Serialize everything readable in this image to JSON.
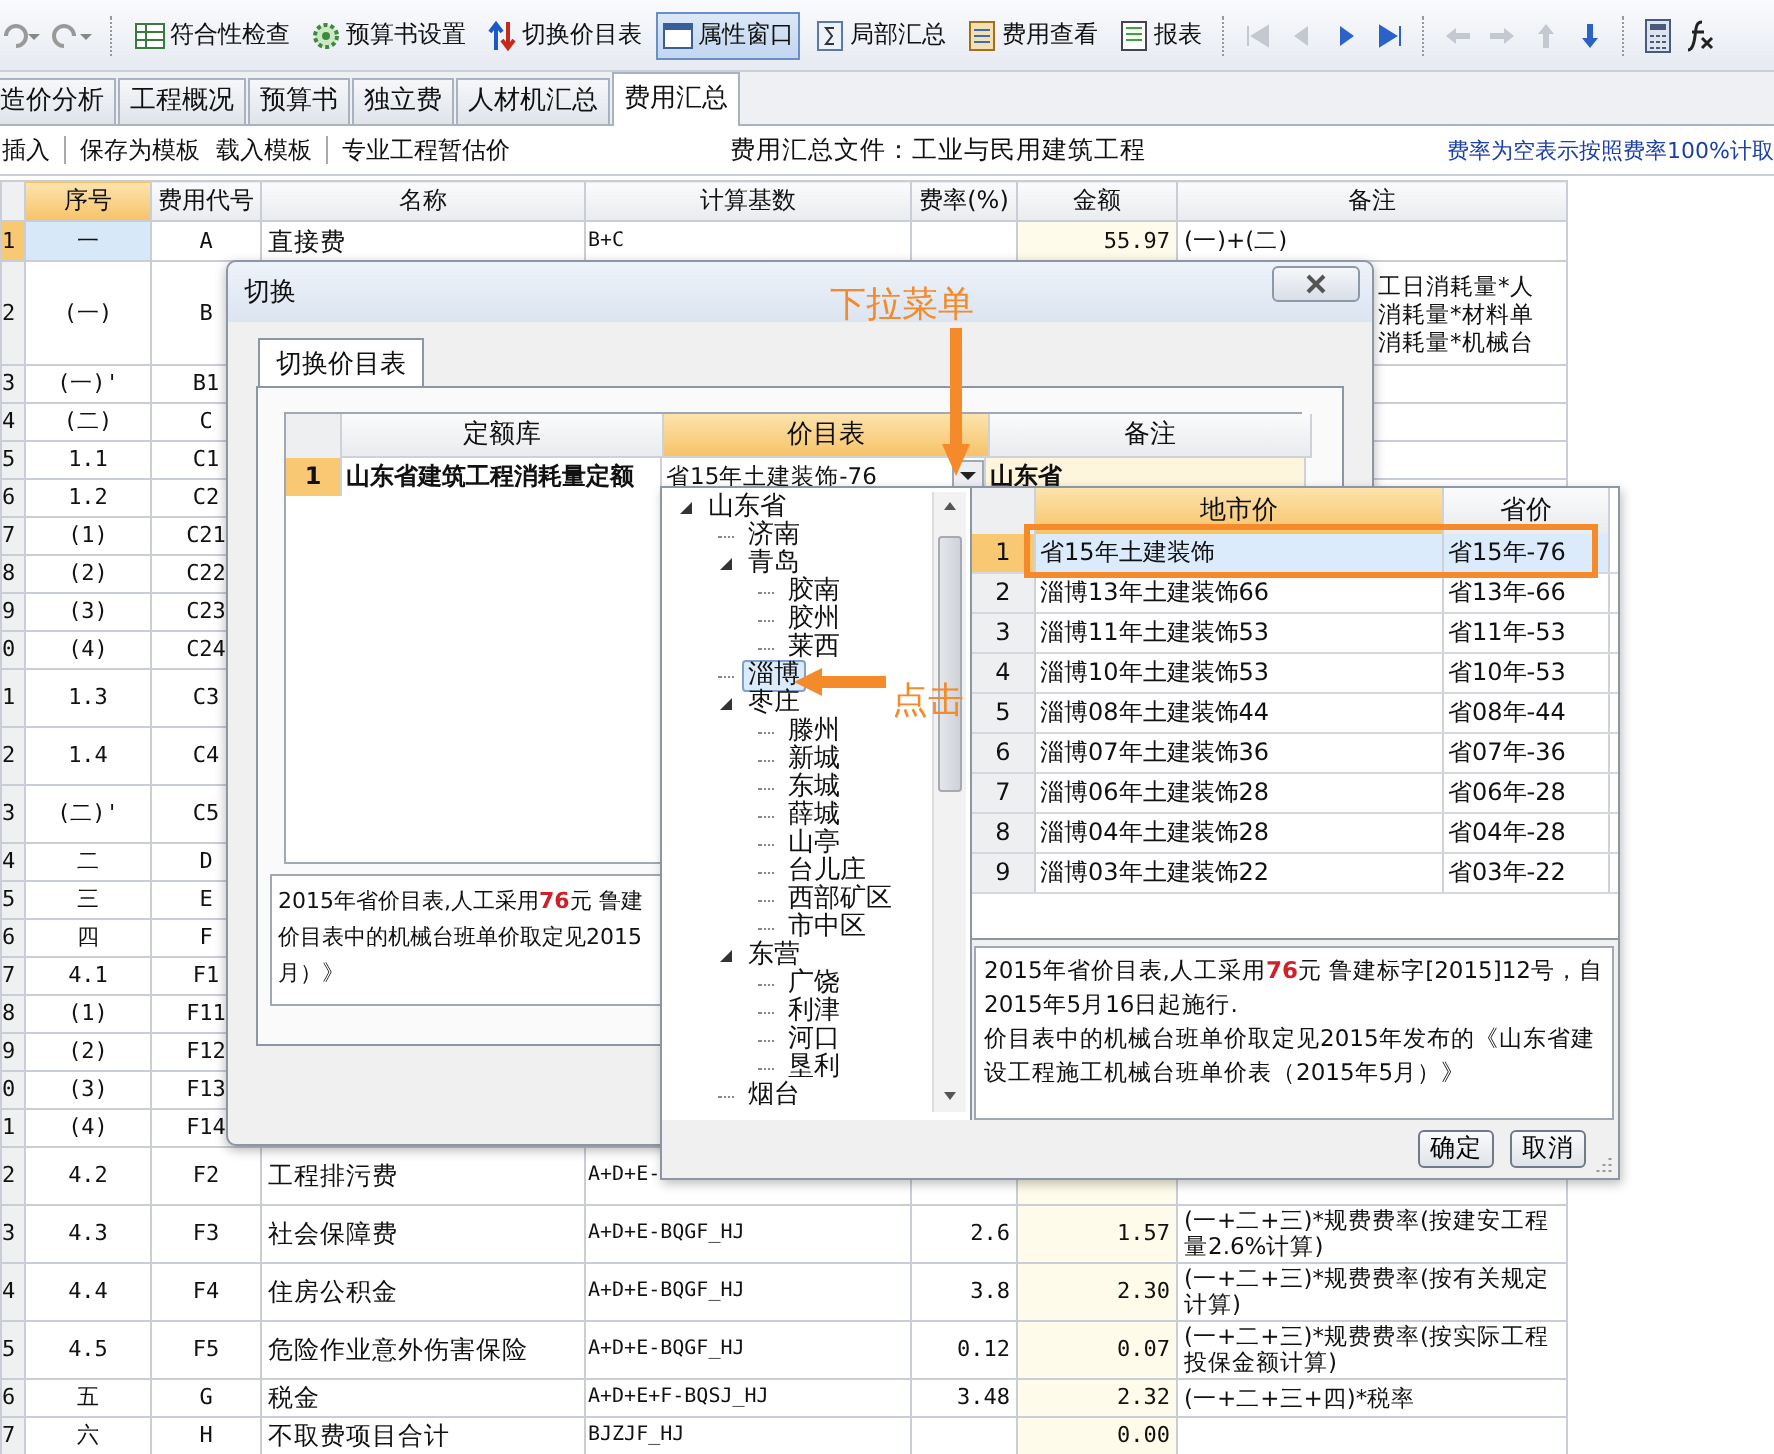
{
  "toolbar": {
    "buttons": [
      {
        "label": "符合性检查",
        "pressed": false
      },
      {
        "label": "预算书设置",
        "pressed": false
      },
      {
        "label": "切换价目表",
        "pressed": false
      },
      {
        "label": "属性窗口",
        "pressed": true
      },
      {
        "label": "局部汇总",
        "pressed": false
      },
      {
        "label": "费用查看",
        "pressed": false
      },
      {
        "label": "报表",
        "pressed": false
      }
    ]
  },
  "tabs": [
    {
      "label": "造价分析",
      "selected": false
    },
    {
      "label": "工程概况",
      "selected": false
    },
    {
      "label": "预算书",
      "selected": false
    },
    {
      "label": "独立费",
      "selected": false
    },
    {
      "label": "人材机汇总",
      "selected": false
    },
    {
      "label": "费用汇总",
      "selected": true
    }
  ],
  "subtoolbar": {
    "actions": [
      "插入",
      "保存为模板",
      "载入模板",
      "专业工程暂估价"
    ],
    "file_label": "费用汇总文件：工业与民用建筑工程",
    "note": "费率为空表示按照费率100%计取"
  },
  "table": {
    "columns": [
      "序号",
      "费用代号",
      "名称",
      "计算基数",
      "费率(%)",
      "金额",
      "备注"
    ],
    "rows": [
      {
        "row_number": "1",
        "serial": "一",
        "code": "A",
        "name": "直接费",
        "base": "B+C",
        "amount": "55.97",
        "remark": "(一)+(二)",
        "selected": true
      },
      {
        "row_number": "2",
        "serial": "(一)",
        "code": "B",
        "remark": "工日消耗量*人消耗量*材料单消耗量*机械台",
        "selected": false
      },
      {
        "row_number": "3",
        "serial": "(一)'",
        "code": "B1",
        "selected": false
      },
      {
        "row_number": "4",
        "serial": "(二)",
        "code": "C",
        "selected": false
      },
      {
        "row_number": "5",
        "serial": "1.1",
        "code": "C1",
        "selected": false
      },
      {
        "row_number": "6",
        "serial": "1.2",
        "code": "C2",
        "selected": false
      },
      {
        "row_number": "7",
        "serial": "(1)",
        "code": "C21",
        "selected": false
      },
      {
        "row_number": "8",
        "serial": "(2)",
        "code": "C22",
        "selected": false
      },
      {
        "row_number": "9",
        "serial": "(3)",
        "code": "C23",
        "selected": false
      },
      {
        "row_number": "0",
        "serial": "(4)",
        "code": "C24",
        "selected": false
      },
      {
        "row_number": "1",
        "serial": "1.3",
        "code": "C3",
        "selected": false
      },
      {
        "row_number": "2",
        "serial": "1.4",
        "code": "C4",
        "selected": false
      },
      {
        "row_number": "3",
        "serial": "(二)'",
        "code": "C5",
        "selected": false
      },
      {
        "row_number": "4",
        "serial": "二",
        "code": "D",
        "selected": false
      },
      {
        "row_number": "5",
        "serial": "三",
        "code": "E",
        "selected": false
      },
      {
        "row_number": "6",
        "serial": "四",
        "code": "F",
        "selected": false
      },
      {
        "row_number": "7",
        "serial": "4.1",
        "code": "F1",
        "selected": false
      },
      {
        "row_number": "8",
        "serial": "(1)",
        "code": "F11",
        "selected": false
      },
      {
        "row_number": "9",
        "serial": "(2)",
        "code": "F12",
        "selected": false
      },
      {
        "row_number": "0",
        "serial": "(3)",
        "code": "F13",
        "selected": false
      },
      {
        "row_number": "1",
        "serial": "(4)",
        "code": "F14",
        "selected": false
      },
      {
        "row_number": "2",
        "serial": "4.2",
        "code": "F2",
        "name": "工程排污费",
        "base": "A+D+E-",
        "selected": false
      },
      {
        "row_number": "3",
        "serial": "4.3",
        "code": "F3",
        "name": "社会保障费",
        "base": "A+D+E-BQGF_HJ",
        "rate": "2.6",
        "amount": "1.57",
        "remark": "(一+二+三)*规费费率(按建安工程量2.6%计算)",
        "selected": false
      },
      {
        "row_number": "4",
        "serial": "4.4",
        "code": "F4",
        "name": "住房公积金",
        "base": "A+D+E-BQGF_HJ",
        "rate": "3.8",
        "amount": "2.30",
        "remark": "(一+二+三)*规费费率(按有关规定计算)",
        "selected": false
      },
      {
        "row_number": "5",
        "serial": "4.5",
        "code": "F5",
        "name": "危险作业意外伤害保险",
        "base": "A+D+E-BQGF_HJ",
        "rate": "0.12",
        "amount": "0.07",
        "remark": "(一+二+三)*规费费率(按实际工程投保金额计算)",
        "selected": false
      },
      {
        "row_number": "6",
        "serial": "五",
        "code": "G",
        "name": "税金",
        "base": "A+D+E+F-BQSJ_HJ",
        "rate": "3.48",
        "amount": "2.32",
        "remark": "(一+二+三+四)*税率",
        "selected": false
      },
      {
        "row_number": "7",
        "serial": "六",
        "code": "H",
        "name": "不取费项目合计",
        "base": "BJZJF_HJ",
        "amount": "0.00",
        "selected": false
      }
    ]
  },
  "dialog": {
    "title": "切换",
    "tab": "切换价目表",
    "columns": [
      "定额库",
      "价目表",
      "备注"
    ],
    "rows": [
      {
        "row_number": "1",
        "quota_library": "山东省建筑工程消耗量定额",
        "price_list": "省15年土建装饰-76",
        "remark": "山东省"
      }
    ],
    "description_lines": [
      "2015年省价目表,人工采用**76**元 鲁建",
      "价目表中的机械台班单价取定见2015",
      "月）》"
    ]
  },
  "popup": {
    "tree": [
      {
        "label": "山东省",
        "expanded": true,
        "selected": false,
        "children": [
          {
            "label": "济南",
            "selected": false
          },
          {
            "label": "青岛",
            "expanded": true,
            "selected": false,
            "children": [
              {
                "label": "胶南",
                "selected": false
              },
              {
                "label": "胶州",
                "selected": false
              },
              {
                "label": "莱西",
                "selected": false
              }
            ]
          },
          {
            "label": "淄博",
            "selected": true
          },
          {
            "label": "枣庄",
            "expanded": true,
            "selected": false,
            "children": [
              {
                "label": "滕州",
                "selected": false
              },
              {
                "label": "新城",
                "selected": false
              },
              {
                "label": "东城",
                "selected": false
              },
              {
                "label": "薛城",
                "selected": false
              },
              {
                "label": "山亭",
                "selected": false
              },
              {
                "label": "台儿庄",
                "selected": false
              },
              {
                "label": "西部矿区",
                "selected": false
              },
              {
                "label": "市中区",
                "selected": false
              }
            ]
          },
          {
            "label": "东营",
            "expanded": true,
            "selected": false,
            "children": [
              {
                "label": "广饶",
                "selected": false
              },
              {
                "label": "利津",
                "selected": false
              },
              {
                "label": "河口",
                "selected": false
              },
              {
                "label": "垦利",
                "selected": false
              }
            ]
          },
          {
            "label": "烟台",
            "selected": false
          }
        ]
      }
    ],
    "columns": [
      "地市价",
      "省价"
    ],
    "rows": [
      {
        "row_number": "1",
        "city_price": "省15年土建装饰",
        "province_price": "省15年-76",
        "selected": true
      },
      {
        "row_number": "2",
        "city_price": "淄博13年土建装饰66",
        "province_price": "省13年-66",
        "selected": false
      },
      {
        "row_number": "3",
        "city_price": "淄博11年土建装饰53",
        "province_price": "省11年-53",
        "selected": false
      },
      {
        "row_number": "4",
        "city_price": "淄博10年土建装饰53",
        "province_price": "省10年-53",
        "selected": false
      },
      {
        "row_number": "5",
        "city_price": "淄博08年土建装饰44",
        "province_price": "省08年-44",
        "selected": false
      },
      {
        "row_number": "6",
        "city_price": "淄博07年土建装饰36",
        "province_price": "省07年-36",
        "selected": false
      },
      {
        "row_number": "7",
        "city_price": "淄博06年土建装饰28",
        "province_price": "省06年-28",
        "selected": false
      },
      {
        "row_number": "8",
        "city_price": "淄博04年土建装饰28",
        "province_price": "省04年-28",
        "selected": false
      },
      {
        "row_number": "9",
        "city_price": "淄博03年土建装饰22",
        "province_price": "省03年-22",
        "selected": false
      }
    ],
    "description": "2015年省价目表,人工采用**76**元 鲁建标字[2015]12号，自2015年5月16日起施行.\n价目表中的机械台班单价取定见2015年发布的《山东省建设工程施工机械台班单价表（2015年5月）》",
    "buttons": [
      "确定",
      "取消"
    ]
  },
  "annotations": {
    "dropdown_label": "下拉菜单",
    "click_label": "点击"
  }
}
